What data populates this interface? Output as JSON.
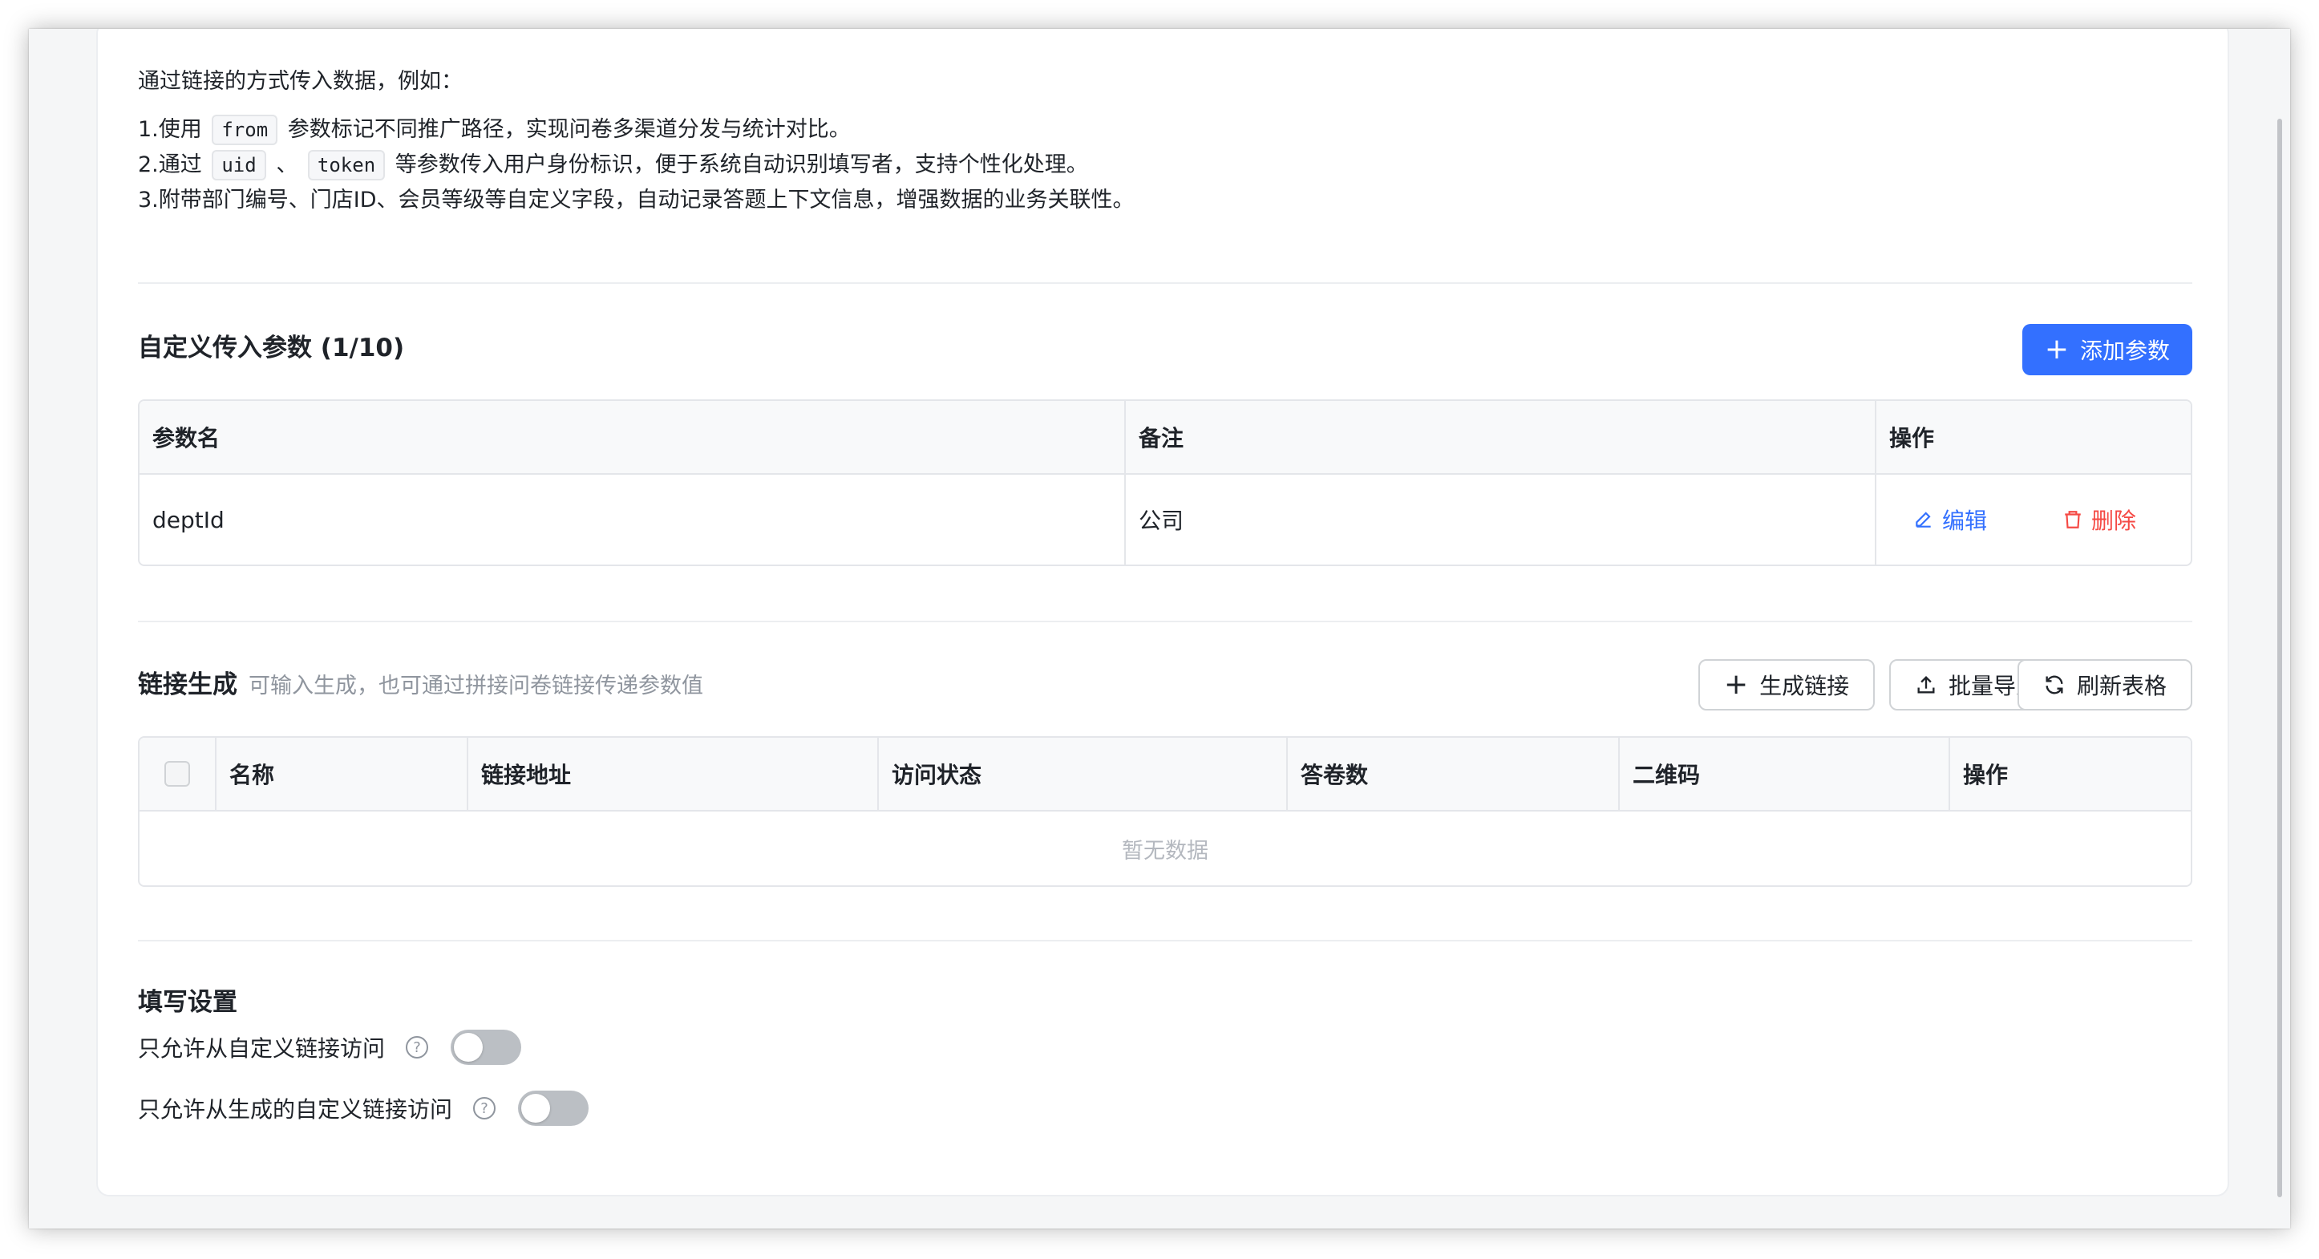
{
  "intro": {
    "line0": "通过链接的方式传入数据，例如：",
    "line1_prefix": "1.使用",
    "line1_code": "from",
    "line1_suffix": "参数标记不同推广路径，实现问卷多渠道分发与统计对比。",
    "line2_prefix": "2.通过",
    "line2_code1": "uid",
    "line2_sep": "、",
    "line2_code2": "token",
    "line2_suffix": "等参数传入用户身份标识，便于系统自动识别填写者，支持个性化处理。",
    "line3": "3.附带部门编号、门店ID、会员等级等自定义字段，自动记录答题上下文信息，增强数据的业务关联性。"
  },
  "params": {
    "title": "自定义传入参数 (1/10)",
    "add_button": "添加参数",
    "columns": [
      "参数名",
      "备注",
      "操作"
    ],
    "rows": [
      {
        "name": "deptId",
        "remark": "公司",
        "edit": "编辑",
        "delete": "删除"
      }
    ]
  },
  "links": {
    "title": "链接生成",
    "hint": "可输入生成，也可通过拼接问卷链接传递参数值",
    "buttons": {
      "generate": "生成链接",
      "import": "批量导入",
      "refresh": "刷新表格"
    },
    "columns": [
      "名称",
      "链接地址",
      "访问状态",
      "答卷数",
      "二维码",
      "操作"
    ],
    "empty_text": "暂无数据"
  },
  "settings": {
    "title": "填写设置",
    "items": [
      {
        "label": "只允许从自定义链接访问",
        "enabled": false
      },
      {
        "label": "只允许从生成的自定义链接访问",
        "enabled": false
      }
    ]
  },
  "colors": {
    "primary": "#3370ff",
    "danger": "#f54a45",
    "toggle_off": "#bbbfc4"
  }
}
